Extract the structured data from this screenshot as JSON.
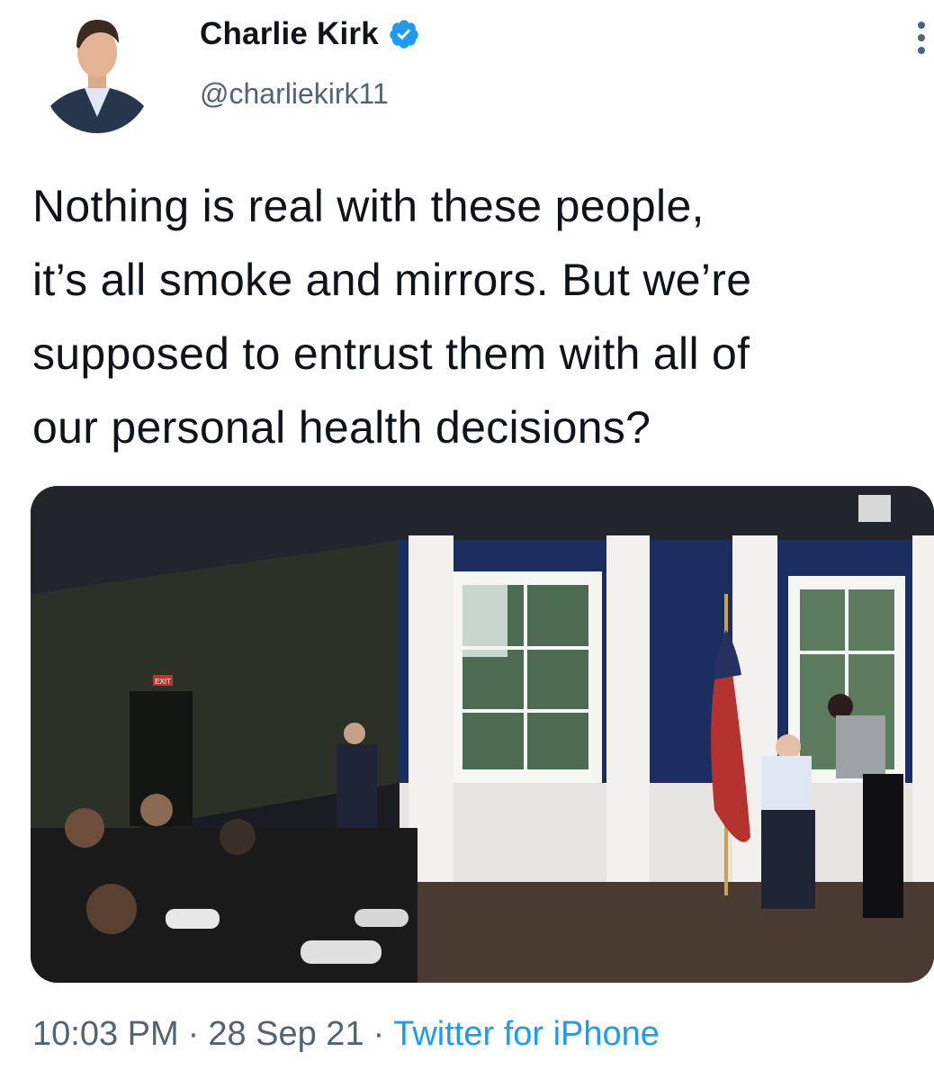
{
  "tweet": {
    "author": {
      "display_name": "Charlie Kirk",
      "handle": "@charliekirk11",
      "verified": true,
      "avatar": "profile-photo"
    },
    "text_lines": [
      "Nothing is real with these people,",
      "it’s all smoke and mirrors. But we’re",
      "supposed to entrust them with all of",
      "our personal health decisions?"
    ],
    "media": {
      "type": "photo",
      "exit_sign": "EXIT"
    },
    "time": "10:03 PM",
    "separator": "·",
    "date": "28 Sep 21",
    "source": "Twitter for iPhone"
  },
  "icons": {
    "verified": "verified-badge-icon",
    "more": "more-vertical-icon"
  },
  "colors": {
    "link": "#1d9bf0",
    "secondary": "#536471",
    "text": "#0f1419"
  }
}
